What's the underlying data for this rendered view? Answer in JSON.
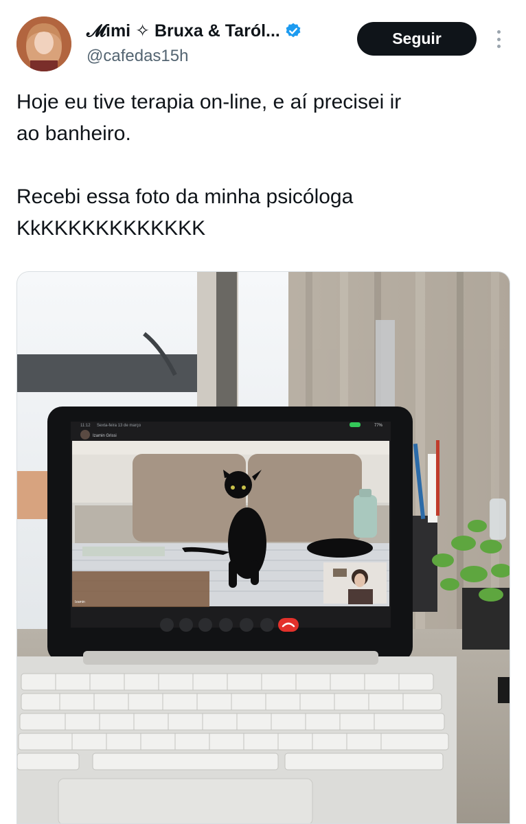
{
  "author": {
    "display_name": "𝓜imi ✧ Bruxa & Taról...",
    "handle": "@cafedas15h",
    "verified": true
  },
  "actions": {
    "follow_label": "Seguir"
  },
  "tweet": {
    "text": "Hoje eu tive terapia on-line, e aí precisei ir\nao banheiro.\n\nRecebi essa foto da minha psicóloga\nKkKKKKKKKKKKKK"
  },
  "colors": {
    "follow_bg": "#0f1419",
    "verified_blue": "#1d9bf0",
    "handle_gray": "#536471"
  },
  "media": {
    "tablet_status": {
      "time": "11:12",
      "date": "Sexta-feira 13 de março",
      "battery": "77%"
    },
    "call": {
      "participant_name": "Izamin Grissi",
      "self_label": "Izamin"
    }
  }
}
